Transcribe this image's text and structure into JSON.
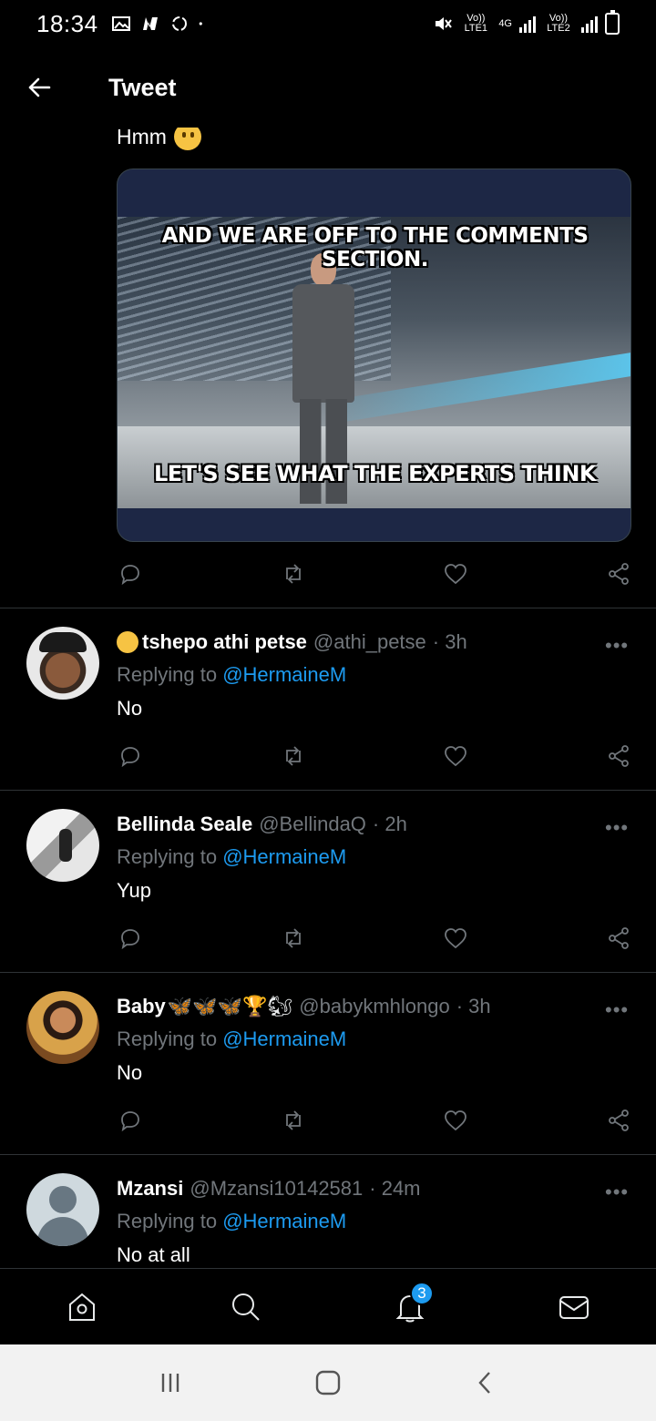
{
  "status_bar": {
    "time": "18:34",
    "net1": "Vo)) LTE1",
    "net_4g": "4G",
    "net2": "Vo)) LTE2"
  },
  "app_bar": {
    "title": "Tweet"
  },
  "main_tweet": {
    "text": "Hmm",
    "emoji": "thinking-face",
    "meme_top": "AND WE ARE OFF TO THE COMMENTS SECTION.",
    "meme_bottom": "LET'S SEE WHAT THE EXPERTS THINK"
  },
  "replies": [
    {
      "name": "tshepo athi petse",
      "handle": "@athi_petse",
      "time": "· 3h",
      "replying_label": "Replying to",
      "mention": "@HermaineM",
      "text": "No"
    },
    {
      "name": "Bellinda Seale",
      "handle": "@BellindaQ",
      "time": "· 2h",
      "replying_label": "Replying to",
      "mention": "@HermaineM",
      "text": "Yup"
    },
    {
      "name": "Baby",
      "name_emojis": "🦋🦋🦋🏆🐿",
      "handle": "@babykmhlongo",
      "time": "· 3h",
      "replying_label": "Replying to",
      "mention": "@HermaineM",
      "text": "No"
    },
    {
      "name": "Mzansi",
      "handle": "@Mzansi10142581",
      "time": "· 24m",
      "replying_label": "Replying to",
      "mention": "@HermaineM",
      "text": "No at all"
    }
  ],
  "bottom_nav": {
    "notifications_badge": "3"
  },
  "colors": {
    "background": "#000000",
    "accent": "#1d9bf0",
    "muted": "#71767b"
  }
}
